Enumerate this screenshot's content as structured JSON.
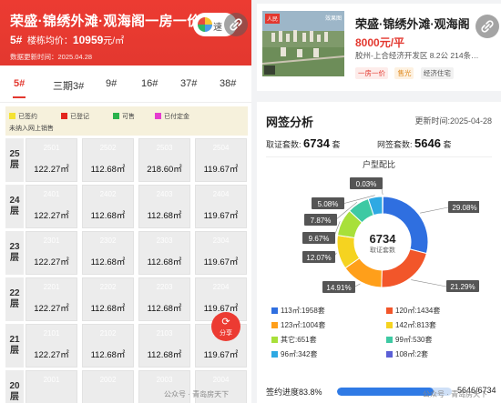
{
  "banner": {
    "title": "荣盛·锦绣外滩·观海阁一房一价",
    "building": "5#",
    "avg_label": "楼栋均价：",
    "avg_price": "10959",
    "avg_unit": "元/㎡",
    "update": "数据更新时间：2025.04.28",
    "pill_text": "速"
  },
  "tabs": [
    "5#",
    "三期3#",
    "9#",
    "16#",
    "37#",
    "38#"
  ],
  "status_legend": [
    {
      "label": "已签约",
      "color": "#f4e233"
    },
    {
      "label": "已登记",
      "color": "#e3261e"
    },
    {
      "label": "可售",
      "color": "#2bb24c"
    },
    {
      "label": "已付定金",
      "color": "#e53ccf"
    },
    {
      "label": "未纳入网上销售",
      "color": ""
    }
  ],
  "floors": [
    {
      "floor": "25\n层",
      "units": [
        {
          "room": "2501",
          "area": "122.27㎡"
        },
        {
          "room": "2502",
          "area": "112.68㎡"
        },
        {
          "room": "2503",
          "area": "218.60㎡"
        },
        {
          "room": "2504",
          "area": "119.67㎡"
        }
      ]
    },
    {
      "floor": "24\n层",
      "units": [
        {
          "room": "2401",
          "area": "122.27㎡"
        },
        {
          "room": "2402",
          "area": "112.68㎡"
        },
        {
          "room": "2403",
          "area": "112.68㎡"
        },
        {
          "room": "2404",
          "area": "119.67㎡"
        }
      ]
    },
    {
      "floor": "23\n层",
      "units": [
        {
          "room": "2301",
          "area": "122.27㎡"
        },
        {
          "room": "2302",
          "area": "112.68㎡"
        },
        {
          "room": "2303",
          "area": "112.68㎡"
        },
        {
          "room": "2304",
          "area": "119.67㎡"
        }
      ]
    },
    {
      "floor": "22\n层",
      "units": [
        {
          "room": "2201",
          "area": "122.27㎡"
        },
        {
          "room": "2202",
          "area": "112.68㎡"
        },
        {
          "room": "2203",
          "area": "112.68㎡"
        },
        {
          "room": "2204",
          "area": "119.67㎡"
        }
      ]
    },
    {
      "floor": "21\n层",
      "units": [
        {
          "room": "2101",
          "area": "122.27㎡"
        },
        {
          "room": "2102",
          "area": "112.68㎡"
        },
        {
          "room": "2103",
          "area": "112.68㎡"
        },
        {
          "room": "2104",
          "area": "119.67㎡"
        }
      ]
    },
    {
      "floor": "20\n层",
      "units": [
        {
          "room": "2001",
          "area": ""
        },
        {
          "room": "2002",
          "area": ""
        },
        {
          "room": "2003",
          "area": ""
        },
        {
          "room": "2004",
          "area": ""
        }
      ]
    }
  ],
  "share_label": "分享",
  "watermark": "公众号 · 青岛房天下",
  "project": {
    "tag": "人民",
    "tag2": "效果图",
    "name": "荣盛·锦绣外滩·观海阁",
    "price": "8000元/平",
    "address": "胶州-上合经济开发区  8.2公  214条…",
    "chips": [
      {
        "label": "一房一价",
        "fg": "#e3382f",
        "bg": "#fdecea"
      },
      {
        "label": "售光",
        "fg": "#e08a1e",
        "bg": "#fdf1e1"
      },
      {
        "label": "经济住宅",
        "fg": "#555",
        "bg": "#f1f1f1"
      }
    ]
  },
  "analysis": {
    "title": "网签分析",
    "update": "更新时间:2025-04-28",
    "license_label": "取证套数:",
    "license_value": "6734",
    "license_unit": "套",
    "sign_label": "网签套数:",
    "sign_value": "5646",
    "sign_unit": "套"
  },
  "chart_data": {
    "type": "pie",
    "title": "户型配比",
    "center_value": "6734",
    "center_label": "取证套数",
    "slices": [
      {
        "name": "113㎡:1958套",
        "value": 1958,
        "pct": "29.08%",
        "color": "#2f6fe0"
      },
      {
        "name": "120㎡:1434套",
        "value": 1434,
        "pct": "21.29%",
        "color": "#f2562a"
      },
      {
        "name": "123㎡:1004套",
        "value": 1004,
        "pct": "14.91%",
        "color": "#ff9f1a"
      },
      {
        "name": "142㎡:813套",
        "value": 813,
        "pct": "12.07%",
        "color": "#f5d320"
      },
      {
        "name": "其它:651套",
        "value": 651,
        "pct": "9.67%",
        "color": "#a8e03a"
      },
      {
        "name": "99㎡:530套",
        "value": 530,
        "pct": "7.87%",
        "color": "#3ec9a3"
      },
      {
        "name": "96㎡:342套",
        "value": 342,
        "pct": "5.08%",
        "color": "#2ea9e3"
      },
      {
        "name": "108㎡:2套",
        "value": 2,
        "pct": "0.03%",
        "color": "#5b5fd6"
      }
    ]
  },
  "progress": {
    "label": "签约进度83.8%",
    "fraction": 0.838,
    "value": "5646/6734"
  }
}
